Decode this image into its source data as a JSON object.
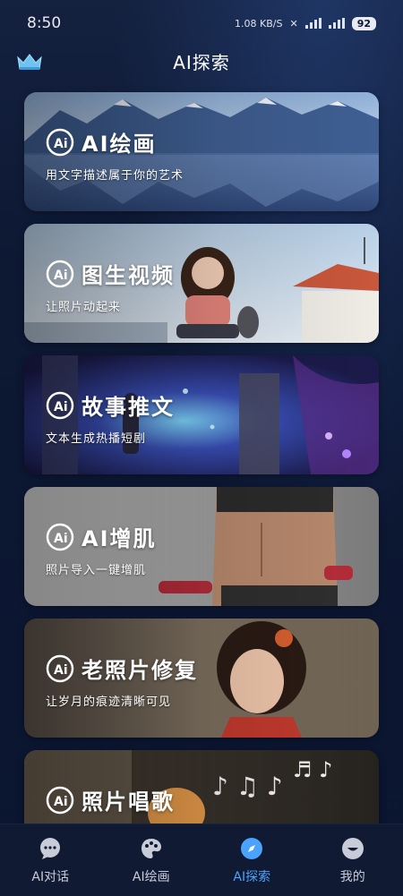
{
  "status": {
    "time": "8:50",
    "network": "1.08 KB/S",
    "battery": "92"
  },
  "header": {
    "title": "AI探索"
  },
  "cards": [
    {
      "title": "AI绘画",
      "subtitle": "用文字描述属于你的艺术"
    },
    {
      "title": "图生视频",
      "subtitle": "让照片动起来"
    },
    {
      "title": "故事推文",
      "subtitle": "文本生成热播短剧"
    },
    {
      "title": "AI增肌",
      "subtitle": "照片导入一键增肌"
    },
    {
      "title": "老照片修复",
      "subtitle": "让岁月的痕迹清晰可见"
    },
    {
      "title": "照片唱歌",
      "subtitle": ""
    }
  ],
  "nav": {
    "items": [
      {
        "label": "AI对话",
        "icon": "chat-bubble-icon"
      },
      {
        "label": "AI绘画",
        "icon": "palette-icon"
      },
      {
        "label": "AI探索",
        "icon": "compass-icon",
        "active": true
      },
      {
        "label": "我的",
        "icon": "profile-icon"
      }
    ],
    "active_color": "#4aa3ff"
  }
}
